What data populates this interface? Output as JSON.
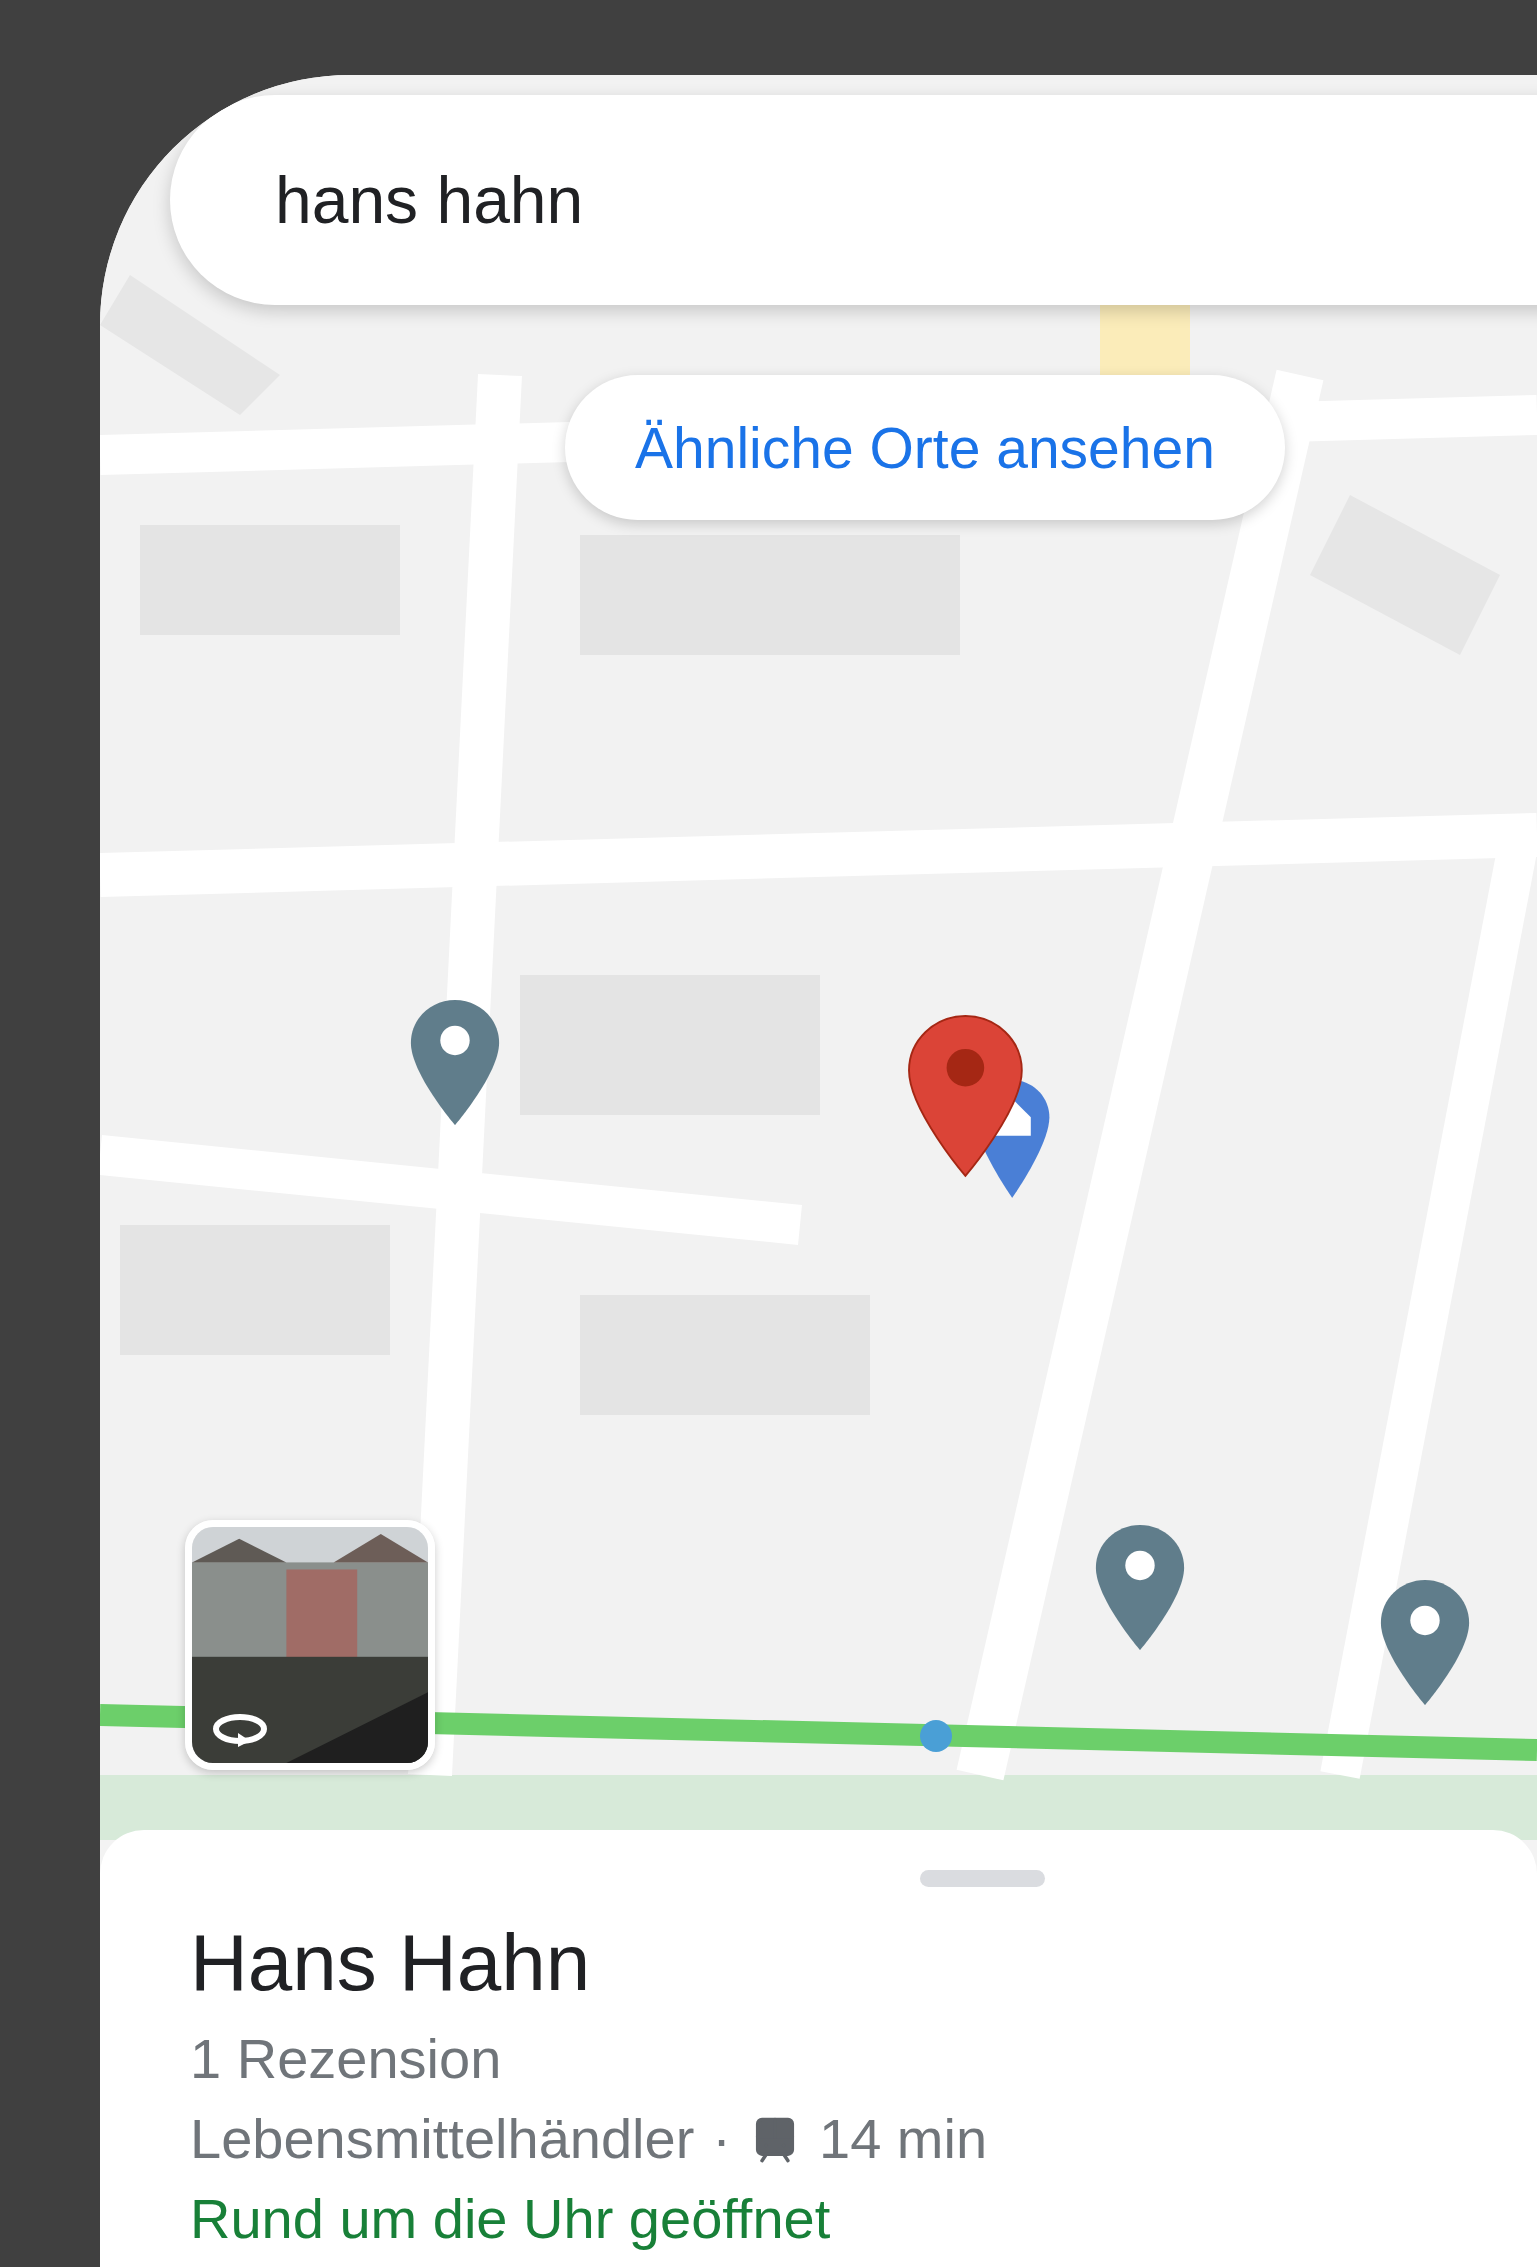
{
  "search": {
    "value": "hans hahn"
  },
  "similar_places_button": {
    "label": "Ähnliche Orte ansehen"
  },
  "place": {
    "name": "Hans Hahn",
    "reviews": "1 Rezension",
    "category": "Lebensmittelhändler",
    "separator": "·",
    "transit_time": "14 min",
    "hours": "Rund um die Uhr geöffnet"
  }
}
